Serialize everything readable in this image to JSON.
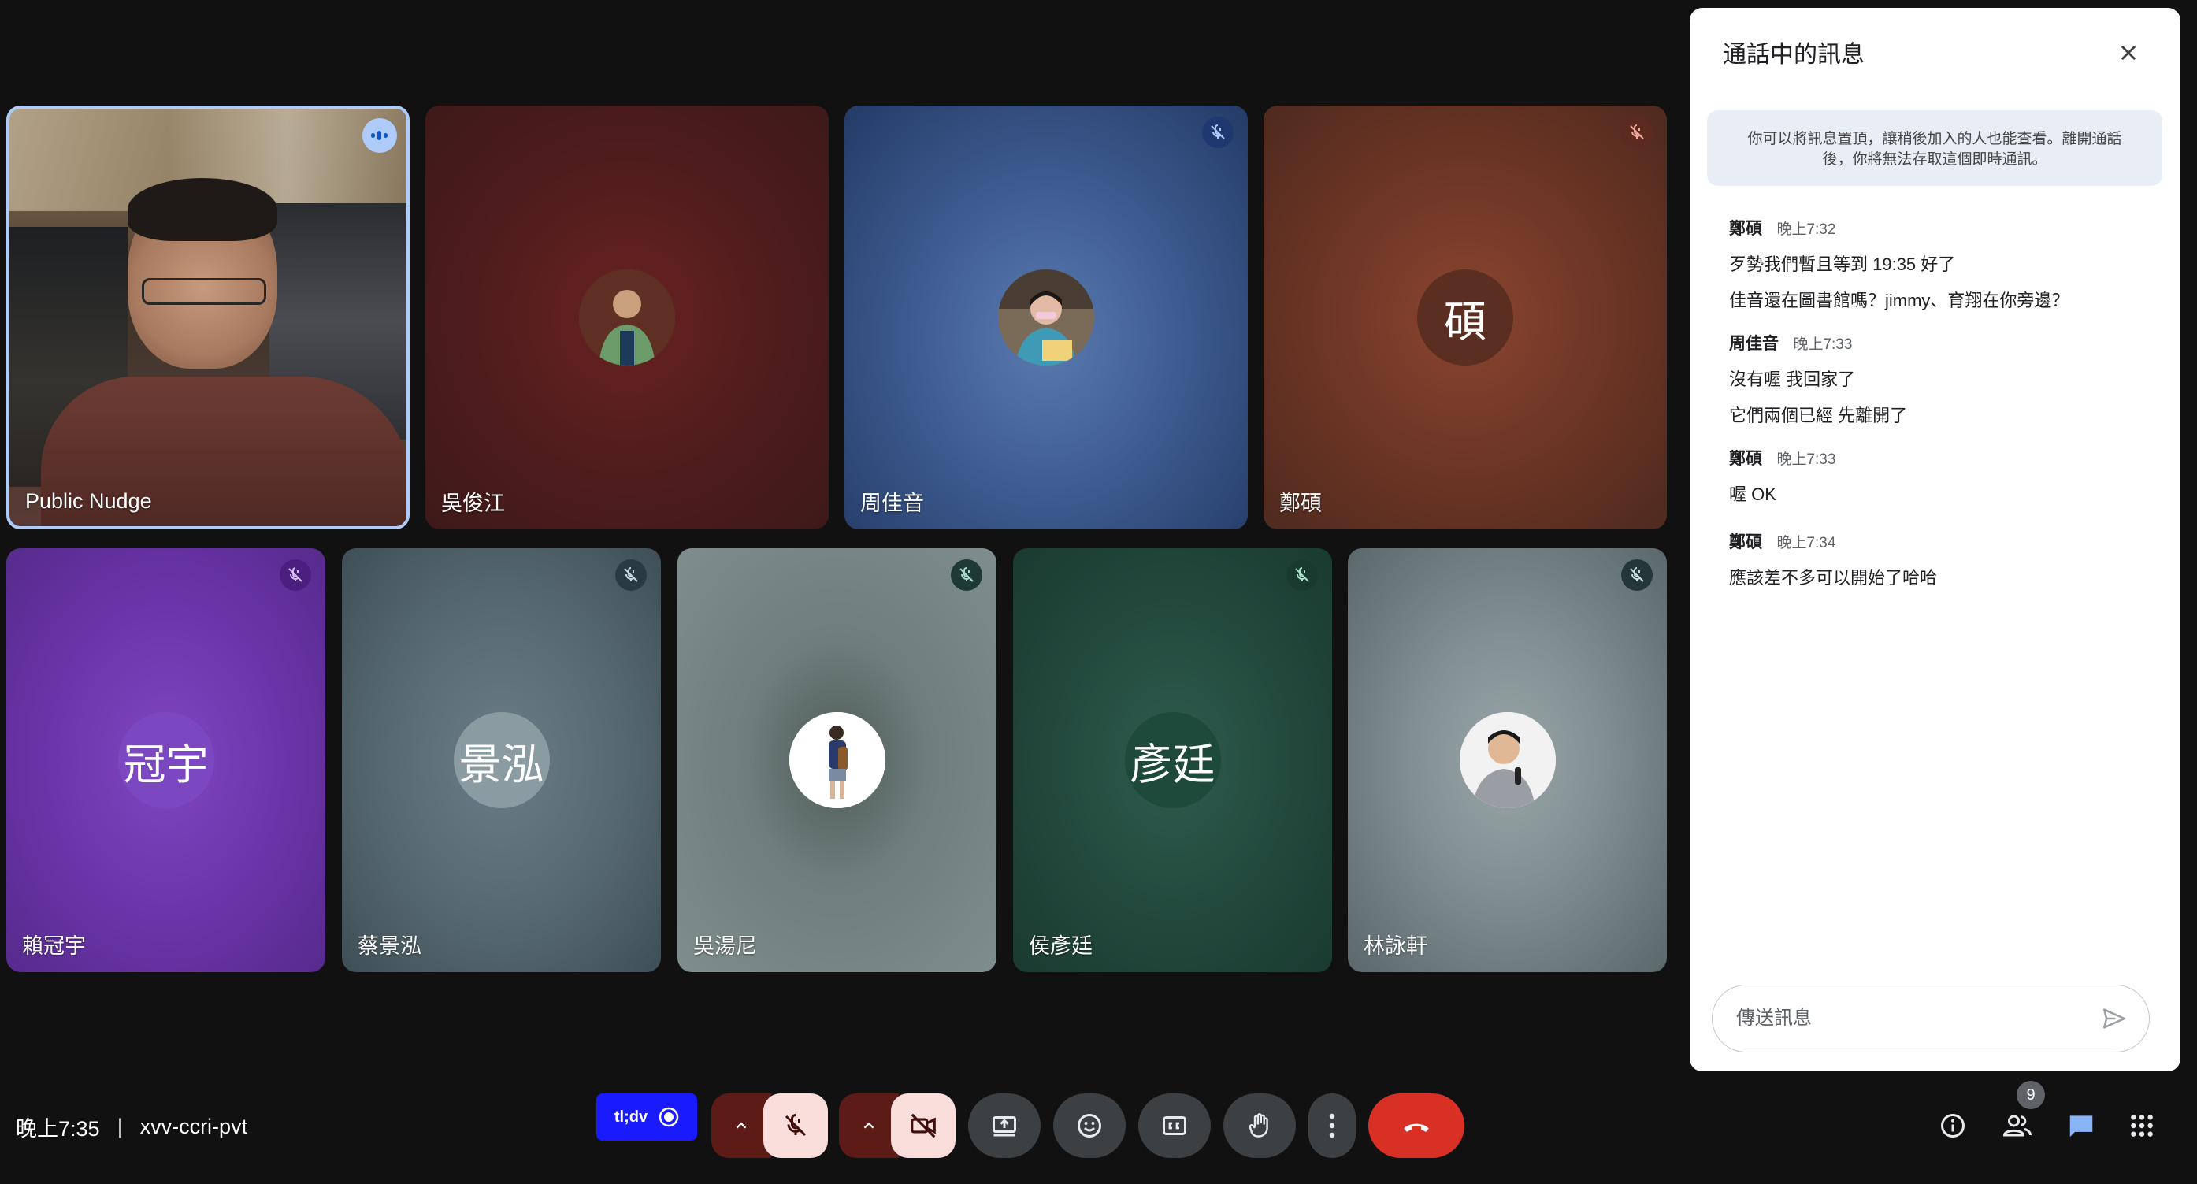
{
  "meeting": {
    "time": "晚上7:35",
    "separator": "|",
    "code": "xvv-ccri-pvt"
  },
  "tiles": [
    {
      "name": "Public Nudge",
      "type": "video",
      "speaking": true
    },
    {
      "name": "吳俊江",
      "type": "photo-avatar",
      "muted": false
    },
    {
      "name": "周佳音",
      "type": "photo-avatar",
      "muted": true
    },
    {
      "name": "鄭碩",
      "type": "initial-avatar",
      "initial": "碩",
      "muted": true
    },
    {
      "name": "賴冠宇",
      "type": "initial-avatar",
      "initial": "冠宇",
      "muted": true
    },
    {
      "name": "蔡景泓",
      "type": "initial-avatar",
      "initial": "景泓",
      "muted": true
    },
    {
      "name": "吳湯尼",
      "type": "photo-avatar",
      "muted": true
    },
    {
      "name": "侯彥廷",
      "type": "initial-avatar",
      "initial": "彥廷",
      "muted": true
    },
    {
      "name": "林詠軒",
      "type": "photo-avatar",
      "muted": true
    }
  ],
  "toolbar": {
    "tldv_label": "tl;dv",
    "icons": [
      "mic-off-icon",
      "camera-off-icon",
      "present-icon",
      "emoji-icon",
      "captions-icon",
      "raise-hand-icon",
      "more-icon",
      "end-call-icon"
    ]
  },
  "right_controls": {
    "participant_count": "9",
    "icons": [
      "info-icon",
      "people-icon",
      "chat-icon",
      "activities-icon"
    ]
  },
  "chat": {
    "title": "通話中的訊息",
    "notice": "你可以將訊息置頂，讓稍後加入的人也能查看。離開通話後，你將無法存取這個即時通訊。",
    "notice_line1": "你可以將訊息置頂，讓稍後加入的人也能查看。離開通話",
    "notice_line2": "後，你將無法存取這個即時通訊。",
    "messages": [
      {
        "sender": "鄭碩",
        "time": "晚上7:32",
        "lines": [
          "歹勢我們暫且等到 19:35 好了",
          "佳音還在圖書館嗎？jimmy、育翔在你旁邊？"
        ]
      },
      {
        "sender": "周佳音",
        "time": "晚上7:33",
        "lines": [
          "沒有喔 我回家了",
          "它們兩個已經 先離開了"
        ]
      },
      {
        "sender": "鄭碩",
        "time": "晚上7:33",
        "lines": [
          "喔 OK"
        ]
      },
      {
        "sender": "鄭碩",
        "time": "晚上7:34",
        "lines": [
          "應該差不多可以開始了哈哈"
        ]
      }
    ],
    "input_placeholder": "傳送訊息"
  },
  "colors": {
    "background": "#111111",
    "end_call": "#d93025",
    "chat_active": "#8ab4f8",
    "tldv": "#1a1aff"
  }
}
